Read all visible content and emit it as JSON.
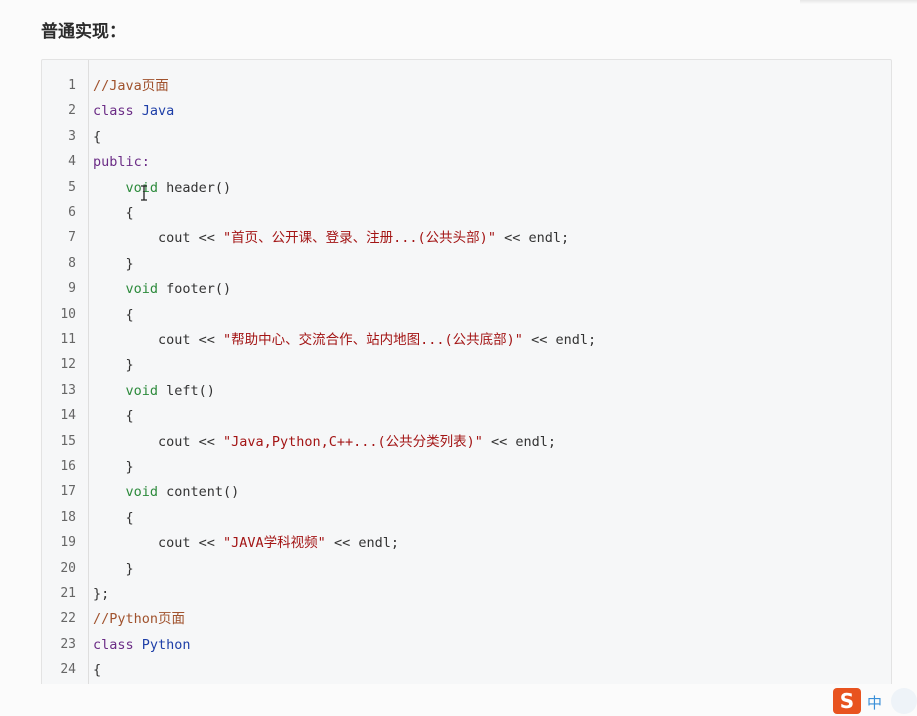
{
  "heading": "普通实现：",
  "code_lines": [
    {
      "n": "1",
      "tokens": [
        {
          "t": "//Java页面",
          "c": "comment"
        }
      ]
    },
    {
      "n": "2",
      "tokens": [
        {
          "t": "class ",
          "c": "kw"
        },
        {
          "t": "Java",
          "c": "cls"
        }
      ]
    },
    {
      "n": "3",
      "tokens": [
        {
          "t": "{",
          "c": "plain"
        }
      ]
    },
    {
      "n": "4",
      "tokens": [
        {
          "t": "public:",
          "c": "kw"
        }
      ]
    },
    {
      "n": "5",
      "tokens": [
        {
          "t": "    ",
          "c": "plain"
        },
        {
          "t": "void",
          "c": "type"
        },
        {
          "t": " header()",
          "c": "plain"
        }
      ]
    },
    {
      "n": "6",
      "tokens": [
        {
          "t": "    {",
          "c": "plain"
        }
      ]
    },
    {
      "n": "7",
      "tokens": [
        {
          "t": "        cout << ",
          "c": "plain"
        },
        {
          "t": "\"首页、公开课、登录、注册...(公共头部)\"",
          "c": "str"
        },
        {
          "t": " << endl;",
          "c": "plain"
        }
      ]
    },
    {
      "n": "8",
      "tokens": [
        {
          "t": "    }",
          "c": "plain"
        }
      ]
    },
    {
      "n": "9",
      "tokens": [
        {
          "t": "    ",
          "c": "plain"
        },
        {
          "t": "void",
          "c": "type"
        },
        {
          "t": " footer()",
          "c": "plain"
        }
      ]
    },
    {
      "n": "10",
      "tokens": [
        {
          "t": "    {",
          "c": "plain"
        }
      ]
    },
    {
      "n": "11",
      "tokens": [
        {
          "t": "        cout << ",
          "c": "plain"
        },
        {
          "t": "\"帮助中心、交流合作、站内地图...(公共底部)\"",
          "c": "str"
        },
        {
          "t": " << endl;",
          "c": "plain"
        }
      ]
    },
    {
      "n": "12",
      "tokens": [
        {
          "t": "    }",
          "c": "plain"
        }
      ]
    },
    {
      "n": "13",
      "tokens": [
        {
          "t": "    ",
          "c": "plain"
        },
        {
          "t": "void",
          "c": "type"
        },
        {
          "t": " left()",
          "c": "plain"
        }
      ]
    },
    {
      "n": "14",
      "tokens": [
        {
          "t": "    {",
          "c": "plain"
        }
      ]
    },
    {
      "n": "15",
      "tokens": [
        {
          "t": "        cout << ",
          "c": "plain"
        },
        {
          "t": "\"Java,Python,C++...(公共分类列表)\"",
          "c": "str"
        },
        {
          "t": " << endl;",
          "c": "plain"
        }
      ]
    },
    {
      "n": "16",
      "tokens": [
        {
          "t": "    }",
          "c": "plain"
        }
      ]
    },
    {
      "n": "17",
      "tokens": [
        {
          "t": "    ",
          "c": "plain"
        },
        {
          "t": "void",
          "c": "type"
        },
        {
          "t": " content()",
          "c": "plain"
        }
      ]
    },
    {
      "n": "18",
      "tokens": [
        {
          "t": "    {",
          "c": "plain"
        }
      ]
    },
    {
      "n": "19",
      "tokens": [
        {
          "t": "        cout << ",
          "c": "plain"
        },
        {
          "t": "\"JAVA学科视频\"",
          "c": "str"
        },
        {
          "t": " << endl;",
          "c": "plain"
        }
      ]
    },
    {
      "n": "20",
      "tokens": [
        {
          "t": "    }",
          "c": "plain"
        }
      ]
    },
    {
      "n": "21",
      "tokens": [
        {
          "t": "};",
          "c": "plain"
        }
      ]
    },
    {
      "n": "22",
      "tokens": [
        {
          "t": "//Python页面",
          "c": "comment"
        }
      ]
    },
    {
      "n": "23",
      "tokens": [
        {
          "t": "class ",
          "c": "kw"
        },
        {
          "t": "Python",
          "c": "cls"
        }
      ]
    },
    {
      "n": "24",
      "tokens": [
        {
          "t": "{",
          "c": "plain"
        }
      ]
    }
  ],
  "ime": {
    "logo": "S",
    "mode": "中",
    "logo_color": "#e8531f",
    "mode_color": "#3a8fd8"
  },
  "colors": {
    "comment": "#a0522d",
    "keyword": "#6b2c86",
    "type": "#2c8a3b",
    "class": "#1e3fa8",
    "string": "#a31515"
  },
  "icons": {
    "cursor": "text-cursor-icon",
    "ime": "sogou-ime-icon"
  }
}
